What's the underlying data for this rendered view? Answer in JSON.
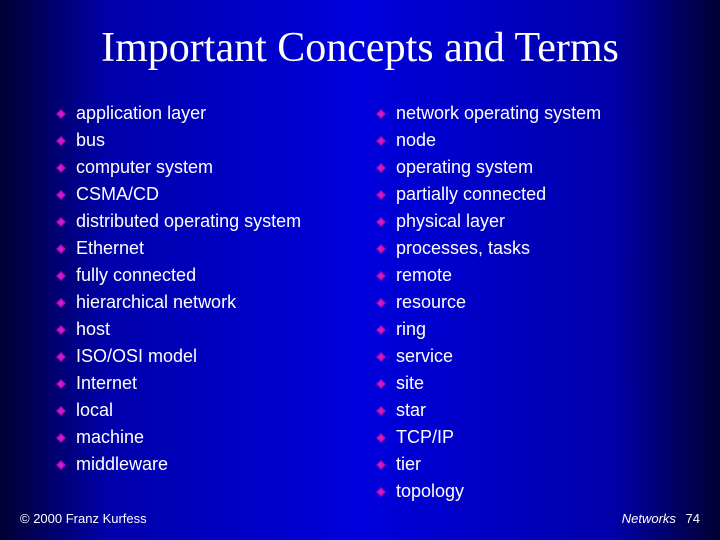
{
  "title": "Important Concepts and Terms",
  "left_items": [
    "application layer",
    "bus",
    "computer system",
    "CSMA/CD",
    "distributed operating system",
    "Ethernet",
    "fully connected",
    "hierarchical network",
    "host",
    "ISO/OSI model",
    "Internet",
    "local",
    "machine",
    "middleware"
  ],
  "right_items": [
    "network operating system",
    "node",
    "operating system",
    "partially connected",
    "physical layer",
    "processes, tasks",
    "remote",
    "resource",
    "ring",
    "service",
    "site",
    "star",
    "TCP/IP",
    "tier",
    "topology"
  ],
  "footer": {
    "copyright": "© 2000 Franz Kurfess",
    "section": "Networks",
    "page": "74"
  },
  "bullet_color": "#b800b8"
}
